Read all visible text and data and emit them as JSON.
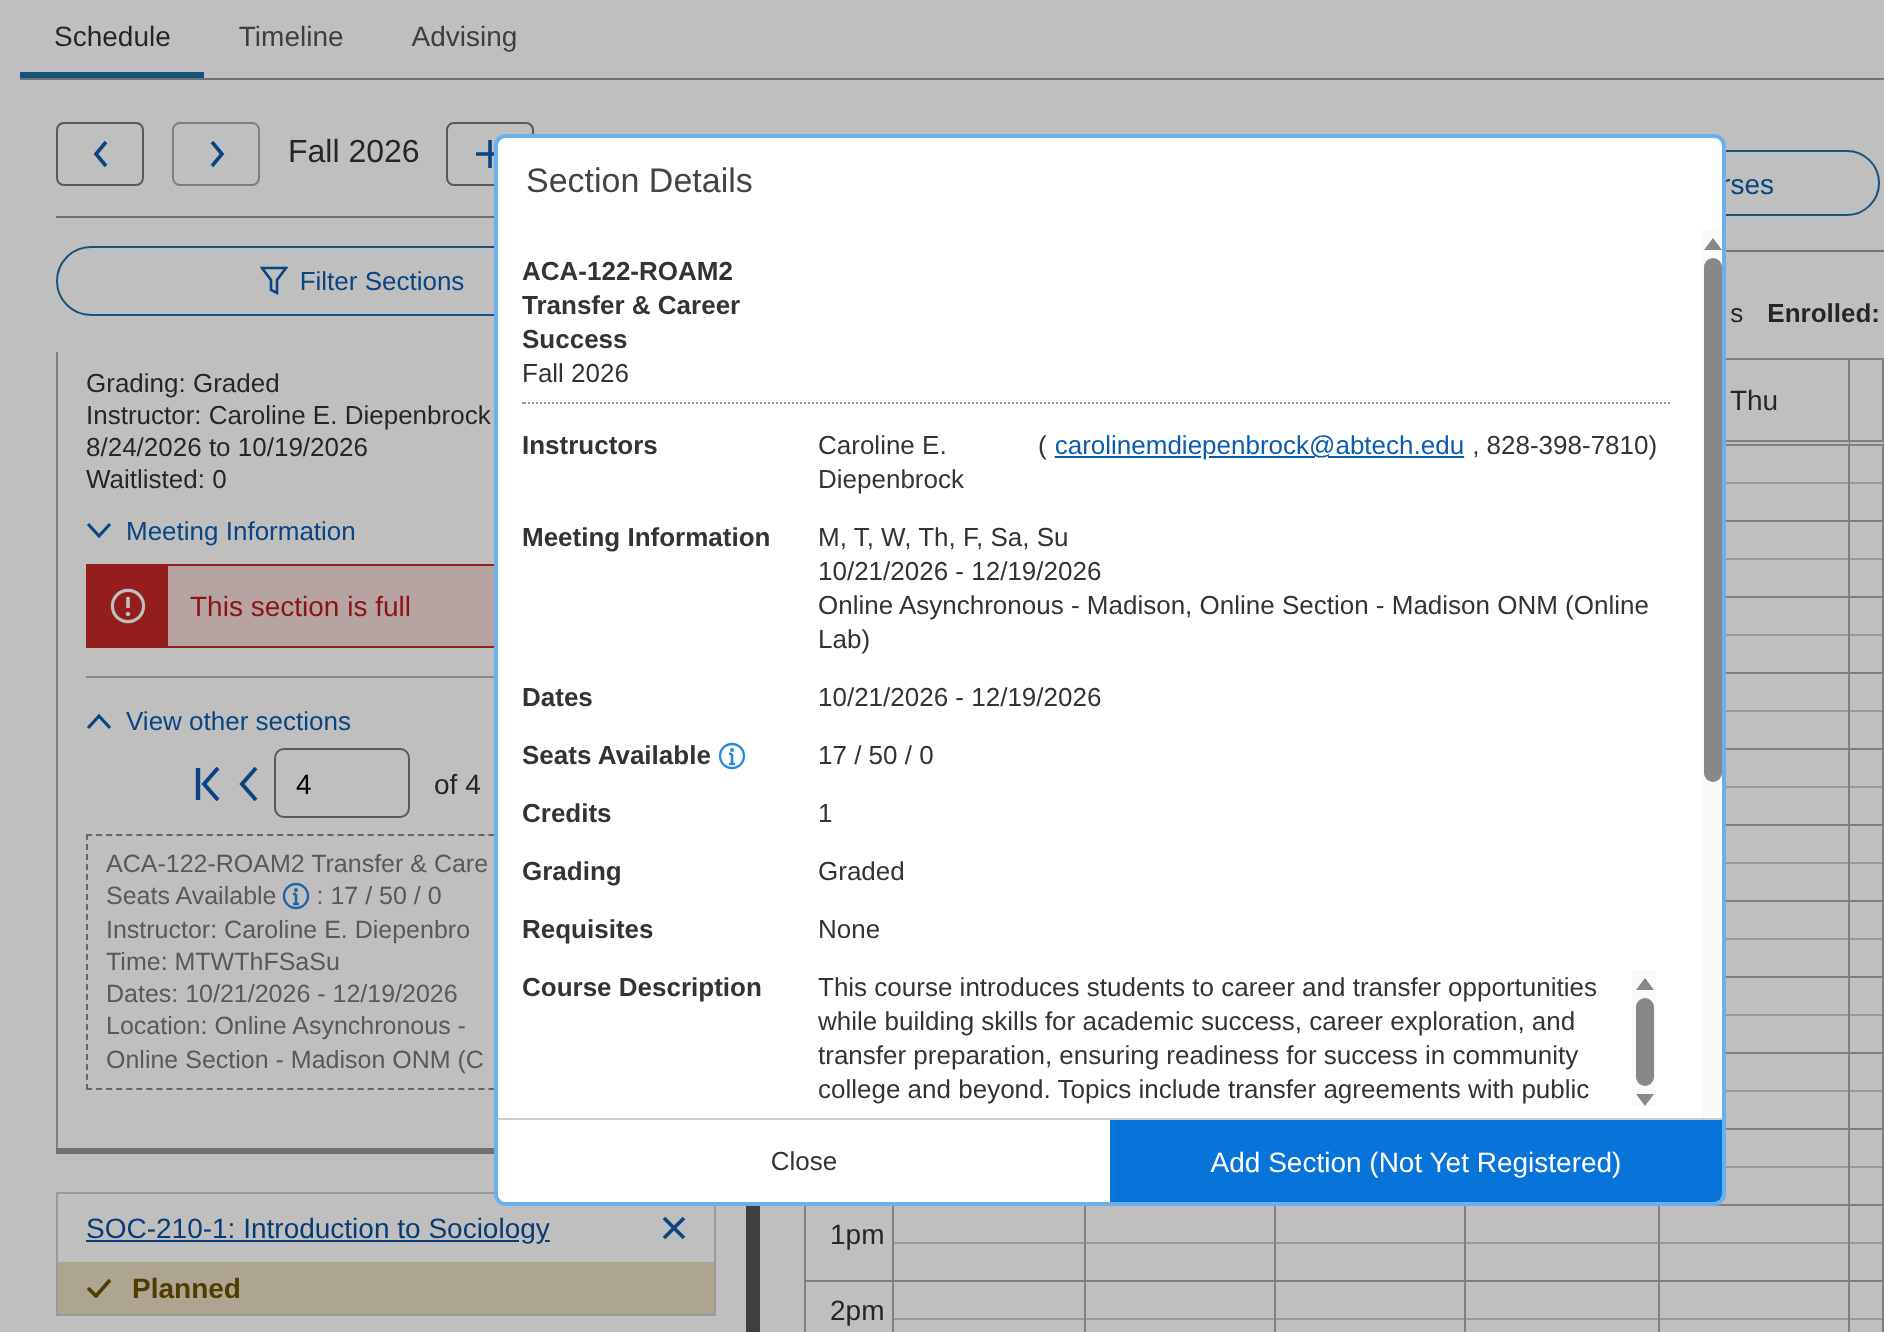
{
  "tabs": [
    {
      "label": "Schedule",
      "selected": true
    },
    {
      "label": "Timeline",
      "selected": false
    },
    {
      "label": "Advising",
      "selected": false
    }
  ],
  "term_nav": {
    "term": "Fall 2026"
  },
  "filter_button": "Filter Sections",
  "courses_button": "rses",
  "summary": {
    "partial": "s",
    "enrolled": "Enrolled:"
  },
  "course_card": {
    "lines": [
      "Grading: Graded",
      "Instructor: Caroline E. Diepenbrock",
      "8/24/2026 to 10/19/2026",
      "Waitlisted:  0"
    ],
    "meeting_toggle": {
      "label": "Meeting Information",
      "expanded": false
    },
    "alert": "This section is full",
    "other_sections_toggle": {
      "label": "View other sections",
      "expanded": true
    },
    "pager": {
      "value": "4",
      "total": "of 4"
    },
    "other_section_lines": [
      {
        "kind": "text",
        "text": "ACA-122-ROAM2 Transfer & Care"
      },
      {
        "kind": "seats",
        "text": "Seats Available",
        "value": ": 17 / 50 / 0"
      },
      {
        "kind": "text",
        "text": "Instructor: Caroline E. Diepenbro"
      },
      {
        "kind": "text",
        "text": "Time: MTWThFSaSu"
      },
      {
        "kind": "text",
        "text": "Dates: 10/21/2026 - 12/19/2026"
      },
      {
        "kind": "text",
        "text": "Location: Online Asynchronous -"
      },
      {
        "kind": "text",
        "text": "Online Section - Madison ONM (C"
      }
    ]
  },
  "next_course": {
    "title": "SOC-210-1: Introduction to Sociology",
    "status": "Planned"
  },
  "calendar": {
    "day_headers": [
      "Thu"
    ],
    "times": [
      "1pm",
      "2pm"
    ]
  },
  "dialog": {
    "title": "Section Details",
    "course_title": "ACA-122-ROAM2 Transfer & Career Success",
    "term": "Fall 2026",
    "rows": [
      {
        "kind": "instructor",
        "label": "Instructors",
        "name": "Caroline E. Diepenbrock",
        "contact_open": "(",
        "email": "carolinemdiepenbrock@abtech.edu",
        "contact_close": ", 828-398-7810)"
      },
      {
        "kind": "lines",
        "label": "Meeting Information",
        "lines": [
          "M, T, W, Th, F, Sa, Su",
          "10/21/2026 - 12/19/2026",
          "Online Asynchronous - Madison, Online Section - Madison ONM (Online Lab)"
        ]
      },
      {
        "kind": "text",
        "label": "Dates",
        "value": "10/21/2026 - 12/19/2026"
      },
      {
        "kind": "info",
        "label": "Seats Available",
        "value": "17 / 50 / 0"
      },
      {
        "kind": "text",
        "label": "Credits",
        "value": "1"
      },
      {
        "kind": "text",
        "label": "Grading",
        "value": "Graded"
      },
      {
        "kind": "text",
        "label": "Requisites",
        "value": "None"
      },
      {
        "kind": "description",
        "label": "Course Description",
        "value": "This course introduces students to career and transfer opportunities while building skills for academic success, career exploration, and transfer preparation, ensuring readiness for success in community college and beyond. Topics include transfer agreements with public"
      }
    ],
    "buttons": [
      {
        "kind": "secondary",
        "label": "Close"
      },
      {
        "kind": "primary",
        "label": "Add Section (Not Yet Registered)"
      }
    ]
  }
}
